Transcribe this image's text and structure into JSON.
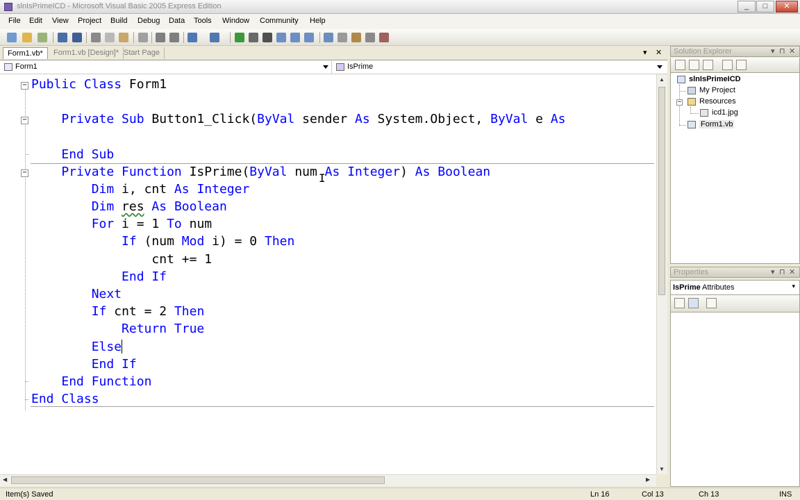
{
  "window": {
    "title": "slnIsPrimeICD - Microsoft Visual Basic 2005 Express Edition"
  },
  "menu": [
    "File",
    "Edit",
    "View",
    "Project",
    "Build",
    "Debug",
    "Data",
    "Tools",
    "Window",
    "Community",
    "Help"
  ],
  "tabs": [
    {
      "label": "Form1.vb*",
      "active": true
    },
    {
      "label": "Form1.vb [Design]*",
      "active": false
    },
    {
      "label": "Start Page",
      "active": false
    }
  ],
  "tab_controls": {
    "dropdown": "▾",
    "close": "✕"
  },
  "editor": {
    "class_combo": "Form1",
    "method_combo": "IsPrime",
    "lines": [
      [
        {
          "t": "Public Class",
          "k": true
        },
        {
          "t": " Form1"
        }
      ],
      [],
      [
        {
          "t": "    "
        },
        {
          "t": "Private Sub",
          "k": true
        },
        {
          "t": " Button1_Click("
        },
        {
          "t": "ByVal",
          "k": true
        },
        {
          "t": " sender "
        },
        {
          "t": "As",
          "k": true
        },
        {
          "t": " System.Object, "
        },
        {
          "t": "ByVal",
          "k": true
        },
        {
          "t": " e "
        },
        {
          "t": "As",
          "k": true
        }
      ],
      [],
      [
        {
          "t": "    "
        },
        {
          "t": "End Sub",
          "k": true
        }
      ],
      [
        {
          "t": "    "
        },
        {
          "t": "Private Function",
          "k": true
        },
        {
          "t": " IsPrime("
        },
        {
          "t": "ByVal",
          "k": true
        },
        {
          "t": " num "
        },
        {
          "t": "As",
          "k": true
        },
        {
          "t": " "
        },
        {
          "t": "Integer",
          "k": true
        },
        {
          "t": ") "
        },
        {
          "t": "As",
          "k": true
        },
        {
          "t": " "
        },
        {
          "t": "Boolean",
          "k": true
        }
      ],
      [
        {
          "t": "        "
        },
        {
          "t": "Dim",
          "k": true
        },
        {
          "t": " i, cnt "
        },
        {
          "t": "As",
          "k": true
        },
        {
          "t": " "
        },
        {
          "t": "Integer",
          "k": true
        }
      ],
      [
        {
          "t": "        "
        },
        {
          "t": "Dim",
          "k": true
        },
        {
          "t": " "
        },
        {
          "t": "res",
          "sq": true
        },
        {
          "t": " "
        },
        {
          "t": "As",
          "k": true
        },
        {
          "t": " "
        },
        {
          "t": "Boolean",
          "k": true
        }
      ],
      [
        {
          "t": "        "
        },
        {
          "t": "For",
          "k": true
        },
        {
          "t": " i = 1 "
        },
        {
          "t": "To",
          "k": true
        },
        {
          "t": " num"
        }
      ],
      [
        {
          "t": "            "
        },
        {
          "t": "If",
          "k": true
        },
        {
          "t": " (num "
        },
        {
          "t": "Mod",
          "k": true
        },
        {
          "t": " i) = 0 "
        },
        {
          "t": "Then",
          "k": true
        }
      ],
      [
        {
          "t": "                cnt += 1"
        }
      ],
      [
        {
          "t": "            "
        },
        {
          "t": "End If",
          "k": true
        }
      ],
      [
        {
          "t": "        "
        },
        {
          "t": "Next",
          "k": true
        }
      ],
      [
        {
          "t": "        "
        },
        {
          "t": "If",
          "k": true
        },
        {
          "t": " cnt = 2 "
        },
        {
          "t": "Then",
          "k": true
        }
      ],
      [
        {
          "t": "            "
        },
        {
          "t": "Return",
          "k": true
        },
        {
          "t": " "
        },
        {
          "t": "True",
          "k": true
        }
      ],
      [
        {
          "t": "        "
        },
        {
          "t": "Else",
          "k": true,
          "caret": true
        }
      ],
      [
        {
          "t": "        "
        },
        {
          "t": "End If",
          "k": true
        }
      ],
      [
        {
          "t": "    "
        },
        {
          "t": "End Function",
          "k": true
        }
      ],
      [
        {
          "t": "End Class",
          "k": true
        }
      ]
    ]
  },
  "solution_explorer": {
    "title": "Solution Explorer",
    "items": [
      {
        "label": "slnIsPrimeICD",
        "bold": true
      },
      {
        "label": "My Project"
      },
      {
        "label": "Resources"
      },
      {
        "label": "icd1.jpg"
      },
      {
        "label": "Form1.vb"
      }
    ]
  },
  "properties": {
    "title": "Properties",
    "object": "IsPrime",
    "object_type": "Attributes"
  },
  "status": {
    "message": "Item(s) Saved",
    "ln": "Ln 16",
    "col": "Col 13",
    "ch": "Ch 13",
    "mode": "INS"
  },
  "colors": {
    "keyword": "#0000ff",
    "text": "#000000"
  }
}
